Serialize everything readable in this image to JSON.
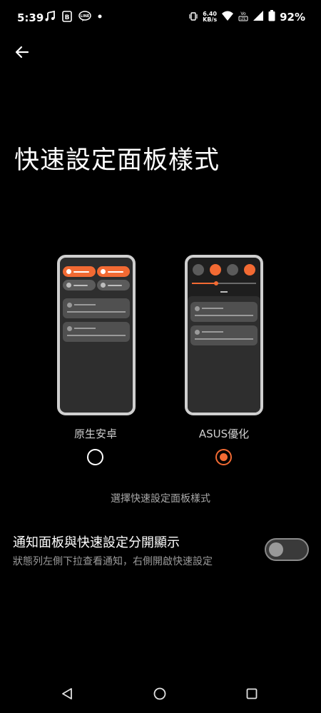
{
  "status_bar": {
    "time": "5:39",
    "net_speed_value": "6.40",
    "net_speed_unit": "KB/s",
    "battery_percent": "92%",
    "icons": [
      "music-note-icon",
      "b-app-icon",
      "line-app-icon",
      "dot-icon",
      "vibrate-icon",
      "wifi-icon",
      "volte-icon",
      "signal-icon",
      "battery-icon"
    ]
  },
  "header": {
    "back_icon": "arrow-left-icon",
    "title": "快速設定面板樣式"
  },
  "options": [
    {
      "label": "原生安卓",
      "selected": false
    },
    {
      "label": "ASUS優化",
      "selected": true
    }
  ],
  "caption": "選擇快速設定面板樣式",
  "setting": {
    "title": "通知面板與快速設定分開顯示",
    "subtitle": "狀態列左側下拉查看通知，右側開啟快速設定",
    "enabled": false
  },
  "nav_bar": {
    "icons": [
      "back-triangle-icon",
      "home-circle-icon",
      "recents-square-icon"
    ]
  },
  "colors": {
    "accent": "#f26a33",
    "background": "#000000",
    "panel": "#2e2e2e"
  }
}
